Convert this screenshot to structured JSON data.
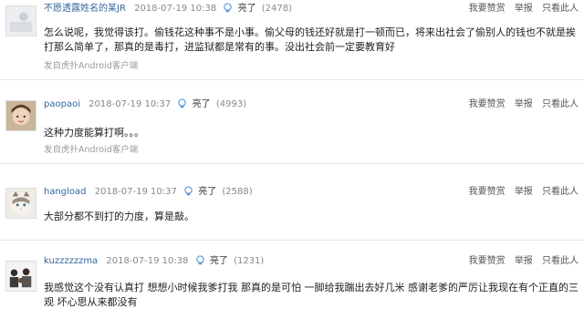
{
  "posts": [
    {
      "username": "不愿透露姓名的某JR",
      "time": "2018-07-19 10:38",
      "light_label": "亮了",
      "light_count": "(2478)",
      "actions": {
        "tip": "我要赞赏",
        "report": "举报",
        "only_this": "只看此人"
      },
      "content": "怎么说呢，我觉得该打。偷钱花这种事不是小事。偷父母的钱还好就是打一顿而已，将来出社会了偷别人的钱也不就是挨打那么简单了，那真的是毒打，进监狱都是常有的事。没出社会前一定要教育好",
      "client": "发自虎扑Android客户端",
      "avatar_icon": "avatar-plain-icon"
    },
    {
      "username": "paopaoi",
      "time": "2018-07-19 10:37",
      "light_label": "亮了",
      "light_count": "(4993)",
      "actions": {
        "tip": "我要赞赏",
        "report": "举报",
        "only_this": "只看此人"
      },
      "content": "这种力度能算打啊。。。",
      "client": "发自虎扑Android客户端",
      "avatar_icon": "avatar-child-icon"
    },
    {
      "username": "hangload",
      "time": "2018-07-19 10:37",
      "light_label": "亮了",
      "light_count": "(2588)",
      "actions": {
        "tip": "我要赞赏",
        "report": "举报",
        "only_this": "只看此人"
      },
      "content": "大部分都不到打的力度，算是敲。",
      "client": "",
      "avatar_icon": "avatar-cat-icon"
    },
    {
      "username": "kuzzzzzzma",
      "time": "2018-07-19 10:38",
      "light_label": "亮了",
      "light_count": "(1231)",
      "actions": {
        "tip": "我要赞赏",
        "report": "举报",
        "only_this": "只看此人"
      },
      "content": "我感觉这个没有认真打 想想小时候我爹打我 那真的是可怕 一脚给我踹出去好几米 感谢老爹的严厉让我现在有个正直的三观 坏心思从来都没有",
      "client": "",
      "avatar_icon": "avatar-group-icon"
    }
  ],
  "colors": {
    "username": "#336699",
    "meta": "#888888",
    "client": "#999999",
    "divider": "#e6e6e6",
    "light_icon": "#5b9bd5"
  }
}
